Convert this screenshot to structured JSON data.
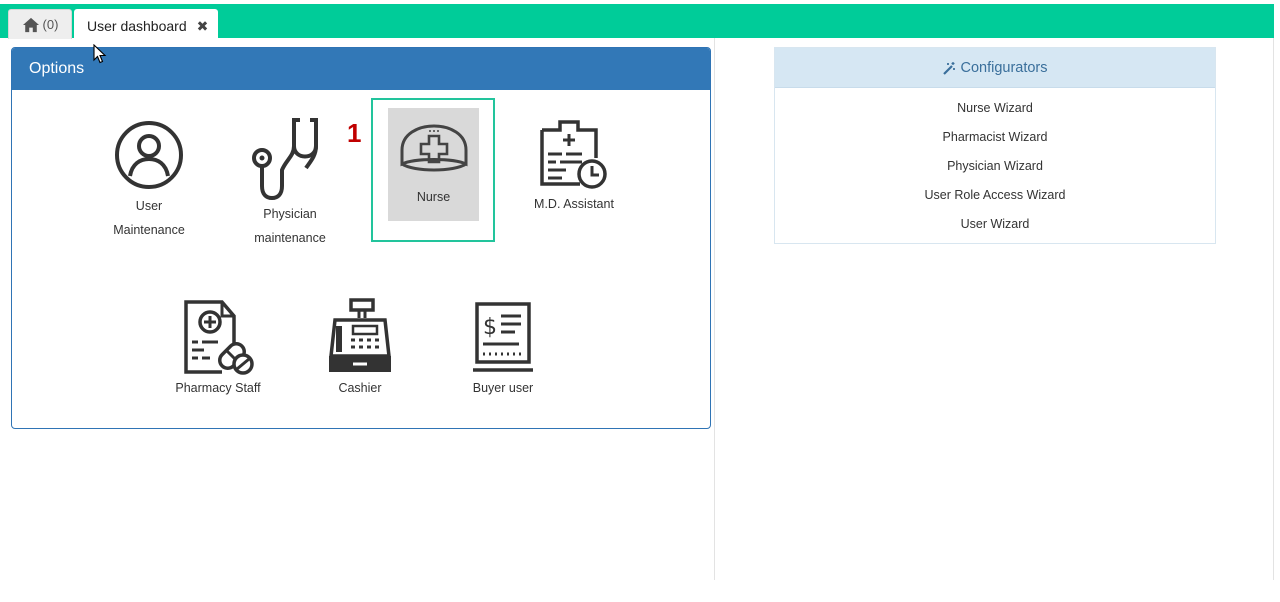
{
  "tabs": {
    "home": {
      "icon": "home-icon",
      "label": "(0)"
    },
    "active": {
      "label": "User dashboard",
      "close_icon": "close-icon",
      "close_glyph": "✖"
    }
  },
  "options": {
    "title": "Options",
    "step_number": "1",
    "items": [
      {
        "id": "user-maintenance",
        "icon": "user-circle-icon",
        "line1": "User",
        "line2": "Maintenance"
      },
      {
        "id": "physician-maintenance",
        "icon": "stethoscope-icon",
        "line1": "Physician",
        "line2": "maintenance"
      },
      {
        "id": "nurse",
        "icon": "nurse-cap-icon",
        "line1": "Nurse",
        "selected": true
      },
      {
        "id": "md-assistant",
        "icon": "medical-calendar-icon",
        "line1": "M.D. Assistant"
      },
      {
        "id": "pharmacy-staff",
        "icon": "prescription-icon",
        "line1": "Pharmacy Staff"
      },
      {
        "id": "cashier",
        "icon": "cash-register-icon",
        "line1": "Cashier"
      },
      {
        "id": "buyer-user",
        "icon": "receipt-icon",
        "line1": "Buyer user"
      }
    ]
  },
  "configurators": {
    "title": "Configurators",
    "icon": "magic-wand-icon",
    "items": [
      "Nurse Wizard",
      "Pharmacist Wizard",
      "Physician Wizard",
      "User Role Access Wizard",
      "User Wizard"
    ]
  },
  "colors": {
    "tab_bar": "#00cc99",
    "panel_header": "#3278b7",
    "selection_border": "#22c49c",
    "step_badge": "#c00000",
    "config_header_bg": "#d6e7f3"
  }
}
